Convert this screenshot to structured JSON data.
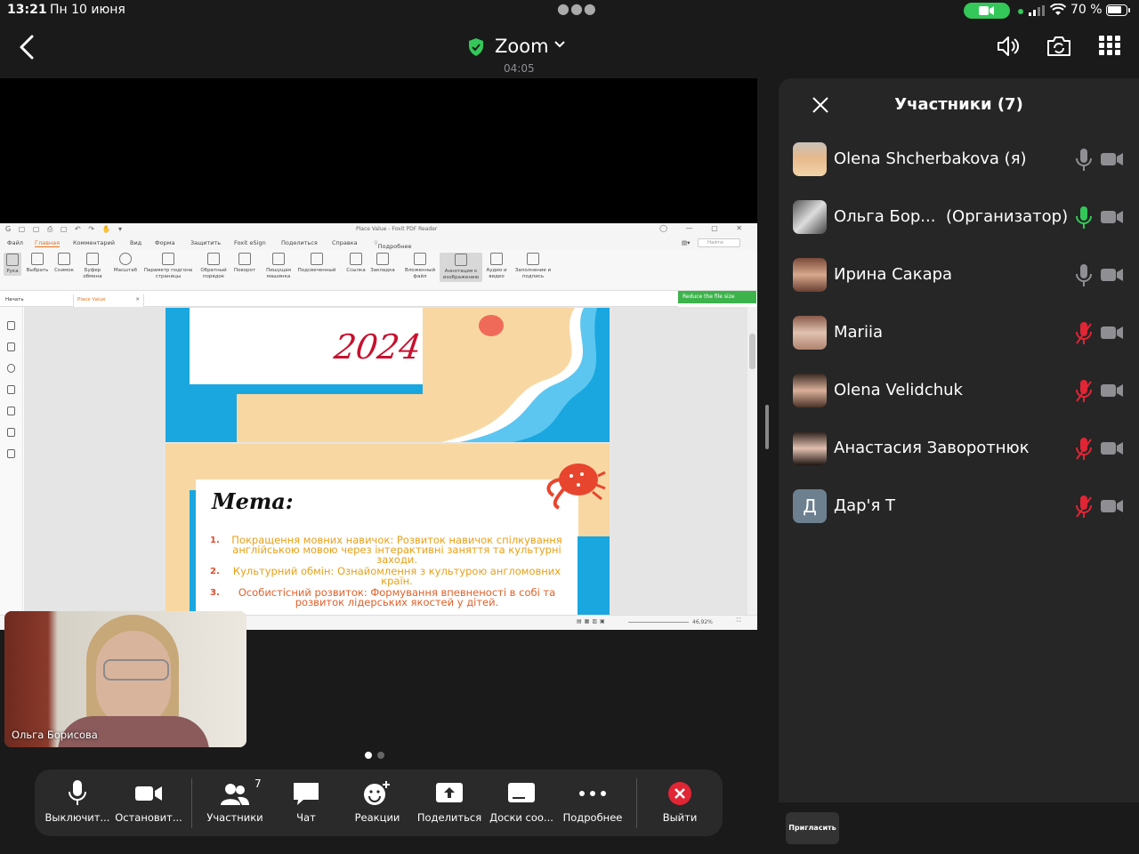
{
  "status": {
    "time": "13:21",
    "date": "Пн 10 июня",
    "battery": "70 %"
  },
  "header": {
    "app_name": "Zoom",
    "timer": "04:05",
    "icons": [
      "back-chevron-icon",
      "speaker-icon",
      "camera-switch-icon",
      "grid-icon"
    ],
    "accent": "#34c759"
  },
  "foxit": {
    "title": "Place Value - Foxit PDF Reader",
    "menu": [
      "Файл",
      "Главная",
      "Комментарий",
      "Вид",
      "Форма",
      "Защитить",
      "Foxit eSign",
      "Поделиться",
      "Справка"
    ],
    "menu_active": "Главная",
    "tell_me": "Подробнее",
    "search_placeholder": "Найти",
    "ribbon": [
      {
        "label": "Рука"
      },
      {
        "label": "Выбрать"
      },
      {
        "label": "Снимок"
      },
      {
        "label": "Буфер обмена"
      },
      {
        "label": "Масштаб"
      },
      {
        "label": "Параметр подгона страницы"
      },
      {
        "label": "Обратный порядок"
      },
      {
        "label": "Поворот"
      },
      {
        "label": "Пишущая машинка"
      },
      {
        "label": "Подсвеченный"
      },
      {
        "label": "Ссылка"
      },
      {
        "label": "Закладка"
      },
      {
        "label": "Вложенный файл"
      },
      {
        "label": "Аннотация к изображению"
      },
      {
        "label": "Аудио и видео"
      },
      {
        "label": "Заполнение и подпись"
      }
    ],
    "reduce_btn": "Reduce the file size",
    "tabs": [
      "Начать",
      "Place Value"
    ],
    "zoom_level": "46,92%"
  },
  "slides": {
    "year": "2024",
    "goal_title": "Мета:",
    "goals": [
      {
        "num": "1.",
        "text": "Покращення мовних навичок: Розвиток навичок спілкування англійською мовою через інтерактивні заняття та культурні заходи."
      },
      {
        "num": "2.",
        "text": "Культурний обмін: Ознайомлення з культурою англомовних країн."
      },
      {
        "num": "3.",
        "text": "Особистісний розвиток: Формування впевненості в собі та розвиток лідерських якостей у дітей."
      }
    ]
  },
  "selfview": {
    "name": "Ольга Борисова"
  },
  "toolbar": {
    "items": [
      {
        "label": "Выключит..."
      },
      {
        "label": "Остановит..."
      },
      {
        "label": "Участники",
        "badge": "7"
      },
      {
        "label": "Чат"
      },
      {
        "label": "Реакции"
      },
      {
        "label": "Поделиться"
      },
      {
        "label": "Доски соо..."
      },
      {
        "label": "Подробнее"
      },
      {
        "label": "Выйти"
      }
    ],
    "leave_color": "#e02535"
  },
  "participants": {
    "title": "Участники (7)",
    "invite": "Пригласить",
    "list": [
      {
        "name": "Olena Shcherbakova (я)",
        "role": "",
        "mic": "on"
      },
      {
        "name": "Ольга Бор...",
        "role": "(Организатор)",
        "mic": "active"
      },
      {
        "name": "Ирина Сакара",
        "role": "",
        "mic": "on"
      },
      {
        "name": "Mariia",
        "role": "",
        "mic": "muted"
      },
      {
        "name": "Olena Velidchuk",
        "role": "",
        "mic": "muted"
      },
      {
        "name": "Анастасия Заворотнюк",
        "role": "",
        "mic": "muted"
      },
      {
        "name": "Дар'я Т",
        "role": "",
        "mic": "muted",
        "initial": "Д"
      }
    ],
    "mic_muted_color": "#e02535",
    "mic_active_color": "#34c759"
  }
}
